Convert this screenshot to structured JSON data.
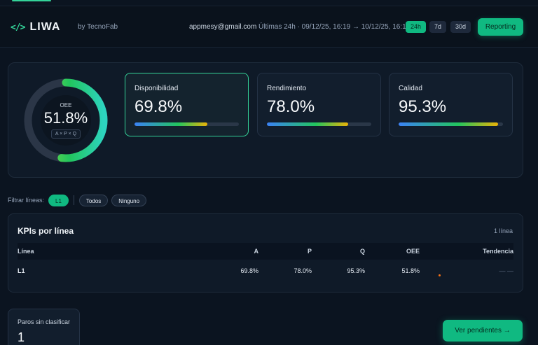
{
  "header": {
    "logo_icon": "</>",
    "logo_text": "LIWA",
    "byline": "by TecnoFab",
    "email": "appmesy@gmail.com",
    "range_text": "Últimas 24h · 09/12/25, 16:19 → 10/12/25, 16:19",
    "range_buttons": [
      "24h",
      "7d",
      "30d"
    ],
    "active_range": "24h",
    "reporting_label": "Reporting"
  },
  "oee": {
    "label": "OEE",
    "value": "51.8%",
    "fraction": 0.518,
    "formula": "A × P × Q"
  },
  "kpis": [
    {
      "title": "Disponibilidad",
      "value": "69.8%",
      "fraction": 0.698,
      "selected": true
    },
    {
      "title": "Rendimiento",
      "value": "78.0%",
      "fraction": 0.78,
      "selected": false
    },
    {
      "title": "Calidad",
      "value": "95.3%",
      "fraction": 0.953,
      "selected": false
    }
  ],
  "filters": {
    "label": "Filtrar líneas:",
    "lines": [
      "L1"
    ],
    "all_label": "Todos",
    "none_label": "Ninguno"
  },
  "table": {
    "title": "KPIs por línea",
    "count": "1 línea",
    "columns": [
      "Línea",
      "A",
      "P",
      "Q",
      "OEE",
      "Tendencia"
    ],
    "rows": [
      {
        "line": "L1",
        "a": "69.8%",
        "p": "78.0%",
        "q": "95.3%",
        "oee": "51.8%",
        "trend": "— —"
      }
    ]
  },
  "unclassified": {
    "label": "Paros sin clasificar",
    "value": "1"
  },
  "pending_button": "Ver pendientes →",
  "colors": {
    "accent": "#10b981",
    "background": "#0b1420",
    "panel": "#0f1a28"
  }
}
